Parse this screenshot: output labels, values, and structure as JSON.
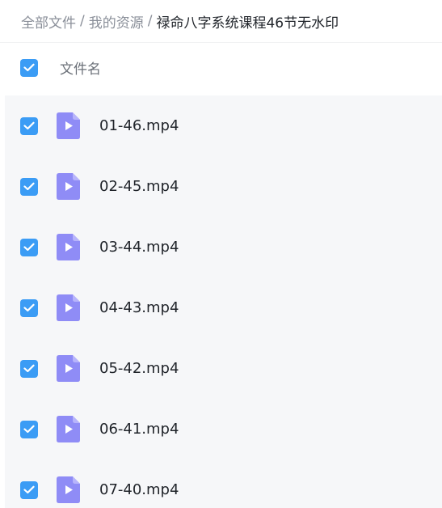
{
  "breadcrumb": {
    "items": [
      "全部文件",
      "我的资源"
    ],
    "separator": "/",
    "current": "禄命八字系统课程46节无水印"
  },
  "list_header": {
    "column_label": "文件名",
    "select_all_checked": true
  },
  "files": [
    {
      "name": "01-46.mp4",
      "checked": true,
      "icon": "video-file-icon"
    },
    {
      "name": "02-45.mp4",
      "checked": true,
      "icon": "video-file-icon"
    },
    {
      "name": "03-44.mp4",
      "checked": true,
      "icon": "video-file-icon"
    },
    {
      "name": "04-43.mp4",
      "checked": true,
      "icon": "video-file-icon"
    },
    {
      "name": "05-42.mp4",
      "checked": true,
      "icon": "video-file-icon"
    },
    {
      "name": "06-41.mp4",
      "checked": true,
      "icon": "video-file-icon"
    },
    {
      "name": "07-40.mp4",
      "checked": true,
      "icon": "video-file-icon"
    }
  ],
  "colors": {
    "checkbox": "#3b9cf5",
    "video_icon": "#8f8cf6",
    "row_background": "#f6f7f9",
    "text_primary": "#1f2329",
    "text_secondary": "#8a8f99"
  }
}
